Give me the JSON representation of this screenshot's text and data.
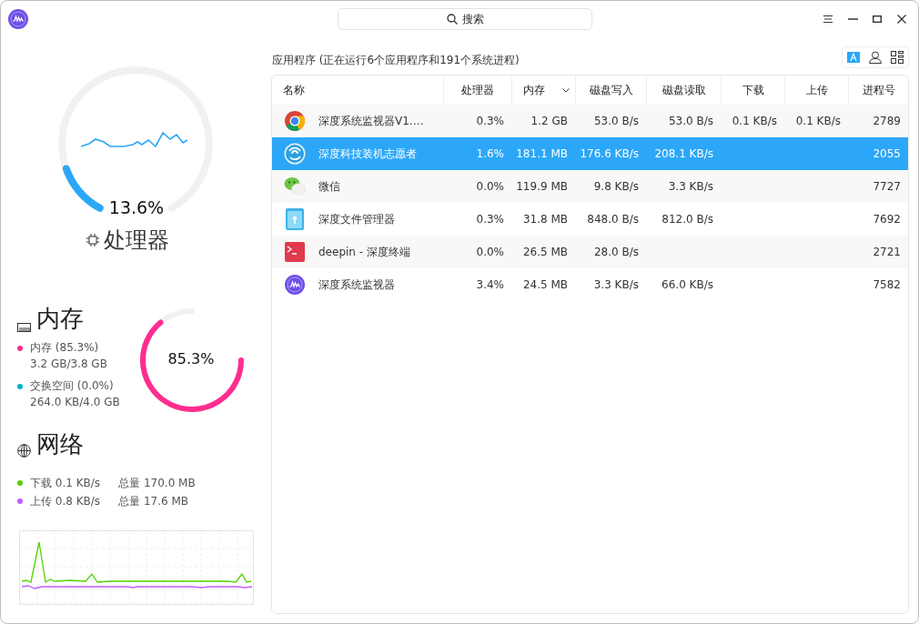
{
  "title_bar": {
    "search_placeholder": "搜索"
  },
  "cpu": {
    "level": 0.136,
    "reading": "13.6%",
    "label": "处理器"
  },
  "memory": {
    "title": "内存",
    "level": 0.853,
    "reading": "85.3%",
    "items": [
      {
        "label": "内存 (85.3%)",
        "value": "3.2 GB/3.8 GB",
        "color": "#ff2d8f"
      },
      {
        "label": "交换空间 (0.0%)",
        "value": "264.0 KB/4.0 GB",
        "color": "#00b5cb"
      }
    ]
  },
  "network": {
    "title": "网络",
    "items": [
      {
        "label": "下载 0.1 KB/s",
        "total": "总量 170.0 MB",
        "color": "#53d100"
      },
      {
        "label": "上传 0.8 KB/s",
        "total": "总量 17.6 MB",
        "color": "#c25cff"
      }
    ]
  },
  "processes": {
    "summary": "应用程序 (正在运行6个应用程序和191个系统进程)",
    "view_buttons": [
      {
        "kind": "apps",
        "selected": true
      },
      {
        "kind": "user",
        "selected": false
      },
      {
        "kind": "all",
        "selected": false
      }
    ],
    "columns": [
      {
        "label": "名称",
        "sorted": false
      },
      {
        "label": "处理器",
        "sorted": false
      },
      {
        "label": "内存",
        "sorted": true
      },
      {
        "label": "磁盘写入",
        "sorted": false
      },
      {
        "label": "磁盘读取",
        "sorted": false
      },
      {
        "label": "下载",
        "sorted": false
      },
      {
        "label": "上传",
        "sorted": false
      },
      {
        "label": "进程号",
        "sorted": false
      }
    ],
    "rows": [
      {
        "kind": "chrome",
        "selected": false,
        "cells": [
          "深度系统监视器V1.…",
          "0.3%",
          "1.2 GB",
          "53.0 B/s",
          "53.0 B/s",
          "0.1 KB/s",
          "0.1 KB/s",
          "2789"
        ]
      },
      {
        "kind": "deepin",
        "selected": true,
        "cells": [
          "深度科技装机志愿者",
          "1.6%",
          "181.1 MB",
          "176.6 KB/s",
          "208.1 KB/s",
          "",
          "",
          "2055"
        ]
      },
      {
        "kind": "wechat",
        "selected": false,
        "cells": [
          "微信",
          "0.0%",
          "119.9 MB",
          "9.8 KB/s",
          "3.3 KB/s",
          "",
          "",
          "7727"
        ]
      },
      {
        "kind": "files",
        "selected": false,
        "cells": [
          "深度文件管理器",
          "0.3%",
          "31.8 MB",
          "848.0 B/s",
          "812.0 B/s",
          "",
          "",
          "7692"
        ]
      },
      {
        "kind": "terminal",
        "selected": false,
        "cells": [
          "deepin - 深度终端",
          "0.0%",
          "26.5 MB",
          "28.0 B/s",
          "",
          "",
          "",
          "2721"
        ]
      },
      {
        "kind": "monitor",
        "selected": false,
        "cells": [
          "深度系统监视器",
          "3.4%",
          "24.5 MB",
          "3.3 KB/s",
          "66.0 KB/s",
          "",
          "",
          "7582"
        ]
      }
    ]
  }
}
